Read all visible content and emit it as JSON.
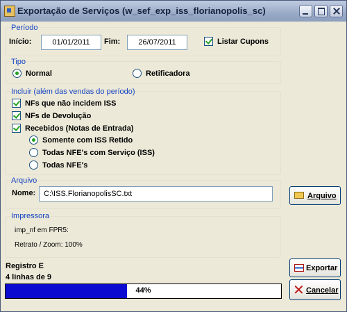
{
  "window": {
    "title": "Exportação de Serviços (w_sef_exp_iss_florianopolis_sc)"
  },
  "periodo": {
    "legend": "Período",
    "inicio_label": "Início:",
    "inicio_value": "01/01/2011",
    "fim_label": "Fim:",
    "fim_value": "26/07/2011",
    "listar_cupons_label": "Listar Cupons",
    "listar_cupons_checked": true
  },
  "tipo": {
    "legend": "Tipo",
    "options": [
      {
        "label": "Normal",
        "selected": true
      },
      {
        "label": "Retificadora",
        "selected": false
      }
    ]
  },
  "incluir": {
    "legend": "Incluir (além das vendas do período)",
    "checkboxes": [
      {
        "label": "NFs que não incidem ISS",
        "checked": true
      },
      {
        "label": "NFs de Devolução",
        "checked": true
      },
      {
        "label": "Recebidos (Notas de Entrada)",
        "checked": true
      }
    ],
    "radios": [
      {
        "label": "Somente com ISS Retido",
        "selected": true
      },
      {
        "label": "Todas NFE's com Serviço (ISS)",
        "selected": false
      },
      {
        "label": "Todas NFE's",
        "selected": false
      }
    ]
  },
  "arquivo": {
    "legend": "Arquivo",
    "nome_label": "Nome:",
    "nome_value": "C:\\ISS.FlorianopolisSC.txt",
    "button_label": "Arquivo"
  },
  "impressora": {
    "legend": "Impressora",
    "line1": "imp_nf em FPR5:",
    "line2": "Retrato / Zoom: 100%"
  },
  "status": {
    "registro": "Registro E",
    "linhas": "4 linhas de 9",
    "progress_percent": 44,
    "progress_text": "44%"
  },
  "buttons": {
    "exportar": "Exportar",
    "cancelar": "Cancelar"
  },
  "colors": {
    "legend": "#1746c4",
    "progress_fill": "#0a0ad0",
    "check": "#21a121"
  }
}
